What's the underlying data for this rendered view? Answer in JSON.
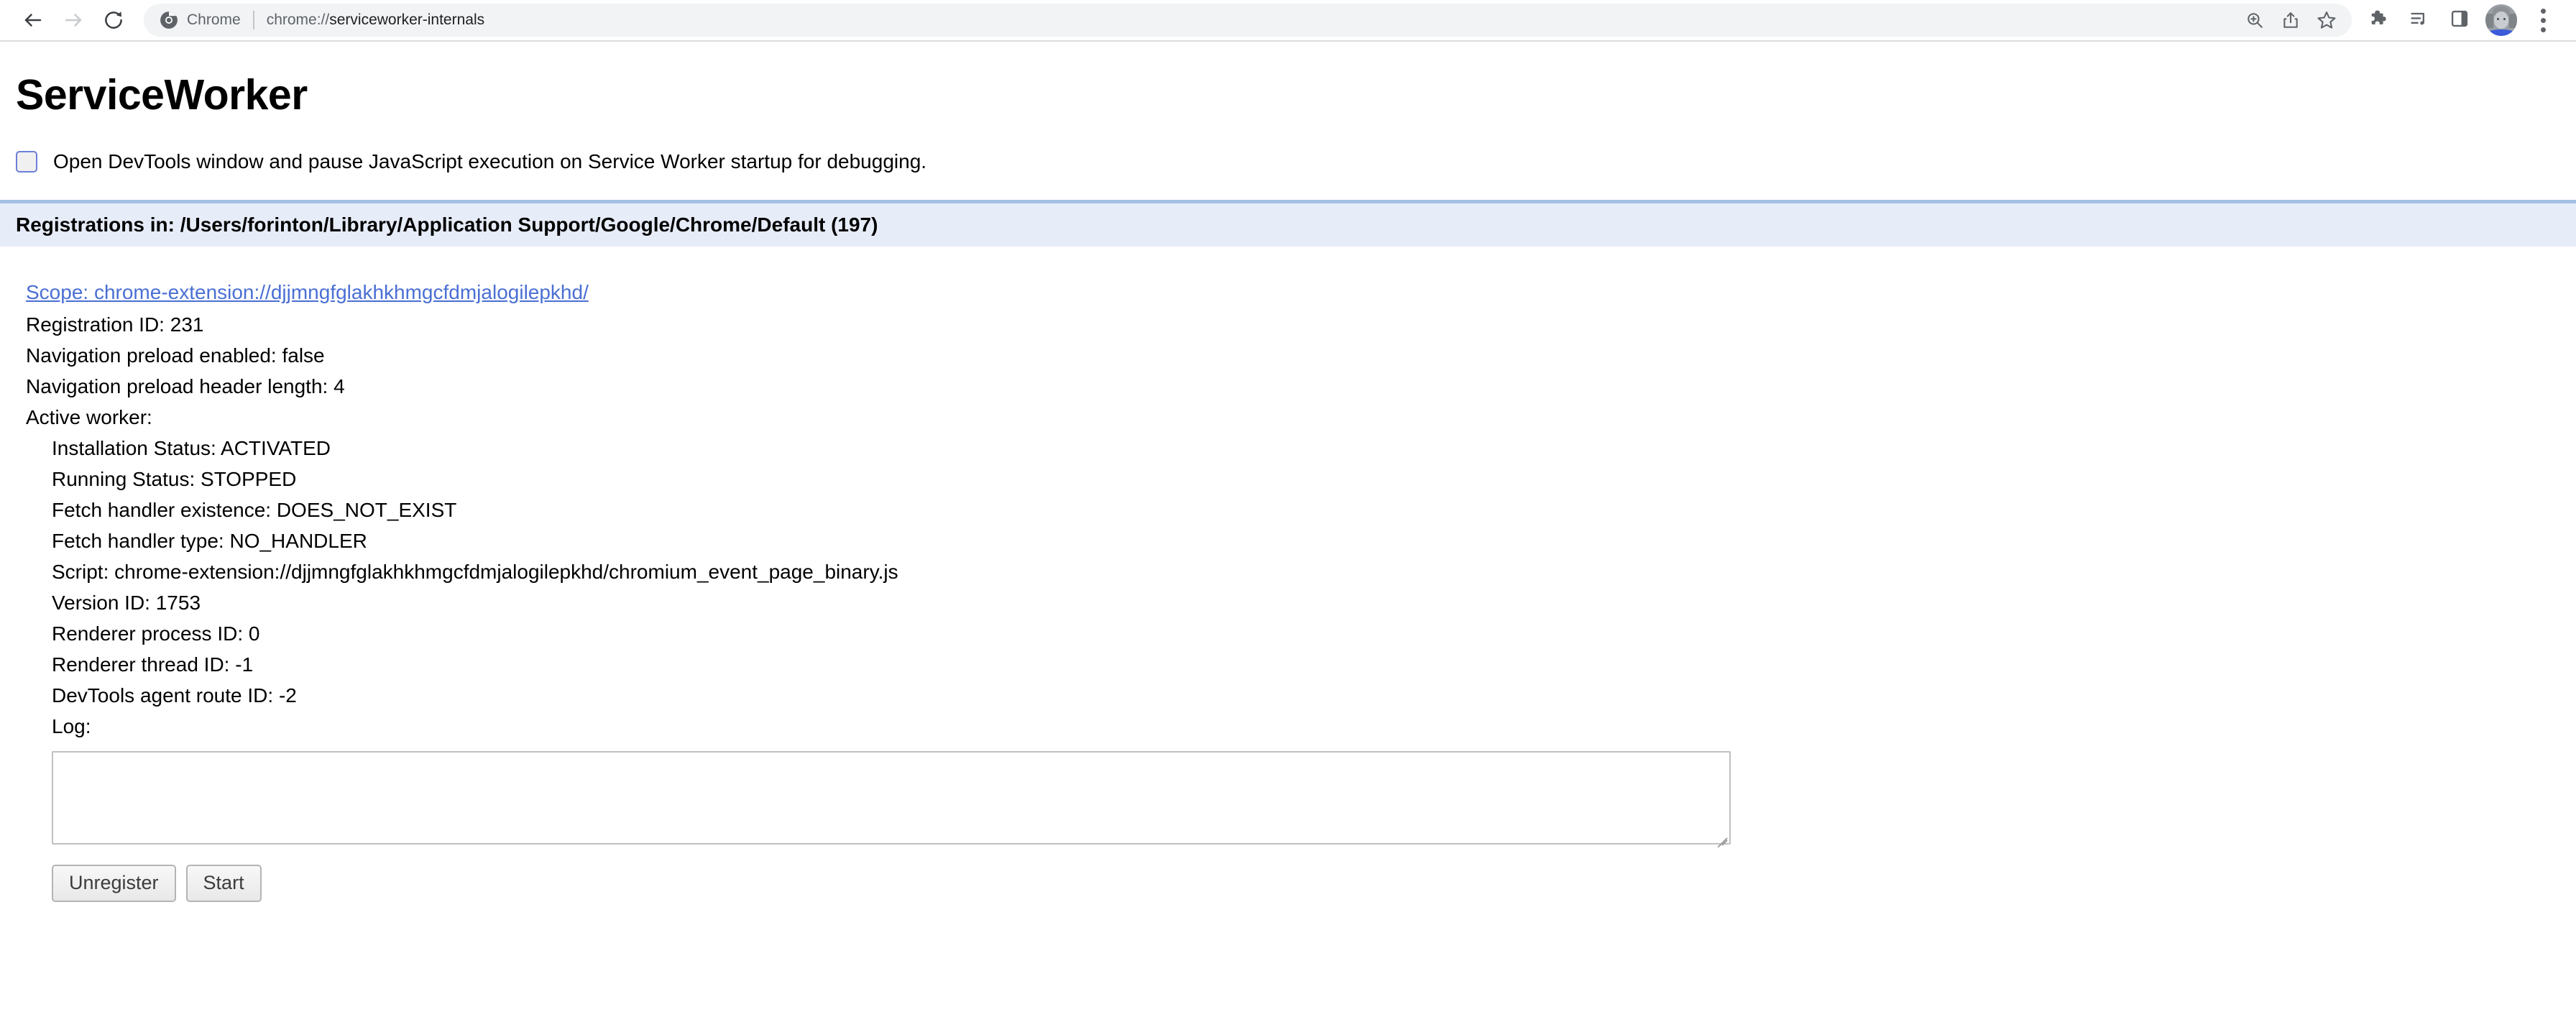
{
  "browser": {
    "nav": {
      "back_icon": "arrow-left-icon",
      "forward_icon": "arrow-right-icon",
      "reload_icon": "reload-icon"
    },
    "omnibox": {
      "chrome_icon": "chrome-logo-icon",
      "chip_label": "Chrome",
      "url_scheme": "chrome://",
      "url_path": "serviceworker-internals",
      "url_full": "chrome://serviceworker-internals",
      "zoom_icon": "zoom-in-icon",
      "share_icon": "share-icon",
      "bookmark_icon": "star-icon"
    },
    "toolbar_right": {
      "extensions_icon": "puzzle-icon",
      "media_icon": "media-playlist-icon",
      "side_panel_icon": "side-panel-icon",
      "avatar_icon": "profile-avatar",
      "menu_icon": "three-dot-menu-icon"
    },
    "colors": {
      "omnibox_bg": "#f1f3f4",
      "toolbar_bg": "#ffffff",
      "toolbar_border": "#dadce0",
      "icon_gray": "#5f6368"
    }
  },
  "page": {
    "title": "ServiceWorker",
    "devtools_checkbox": {
      "label": "Open DevTools window and pause JavaScript execution on Service Worker startup for debugging.",
      "checked": false
    },
    "registrations_header": "Registrations in: /Users/forinton/Library/Application Support/Google/Chrome/Default (197)",
    "registration": {
      "scope": "Scope: chrome-extension://djjmngfglakhkhmgcfdmjalogilepkhd/",
      "registration_id": "Registration ID: 231",
      "nav_preload_enabled": "Navigation preload enabled: false",
      "nav_preload_header_length": "Navigation preload header length: 4",
      "active_worker_label": "Active worker:",
      "active_worker": {
        "installation_status": "Installation Status: ACTIVATED",
        "running_status": "Running Status: STOPPED",
        "fetch_handler_existence": "Fetch handler existence: DOES_NOT_EXIST",
        "fetch_handler_type": "Fetch handler type: NO_HANDLER",
        "script": "Script: chrome-extension://djjmngfglakhkhmgcfdmjalogilepkhd/chromium_event_page_binary.js",
        "version_id": "Version ID: 1753",
        "renderer_process_id": "Renderer process ID: 0",
        "renderer_thread_id": "Renderer thread ID: -1",
        "devtools_agent_route_id": "DevTools agent route ID: -2",
        "log_label": "Log:",
        "log_value": ""
      }
    },
    "buttons": {
      "unregister": "Unregister",
      "start": "Start"
    },
    "colors": {
      "link": "#4a6fd4",
      "section_header_bg": "#e6ecf8",
      "section_header_border": "#a3c0e4",
      "checkbox_border": "#6c7fd8"
    }
  }
}
